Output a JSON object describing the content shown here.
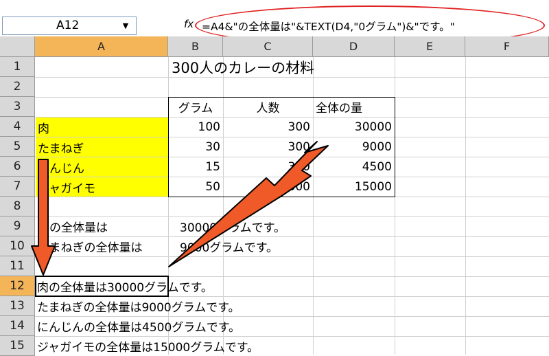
{
  "formula_bar": {
    "name_box": "A12",
    "name_box_dropdown": "▼",
    "fx_label": "fx",
    "formula": "=A4&\"の全体量は\"&TEXT(D4,\"0グラム\")&\"です。\""
  },
  "columns": [
    "A",
    "B",
    "C",
    "D",
    "E",
    "F"
  ],
  "rows": [
    "1",
    "2",
    "3",
    "4",
    "5",
    "6",
    "7",
    "8",
    "9",
    "10",
    "11",
    "12",
    "13",
    "14",
    "15"
  ],
  "cells": {
    "title": "300人のカレーの材料",
    "headers": {
      "b": "グラム",
      "c": "人数",
      "d": "全体の量"
    },
    "ingredients": [
      {
        "a": "肉",
        "b": "100",
        "c": "300",
        "d": "30000"
      },
      {
        "a": "たまねぎ",
        "b": "30",
        "c": "300",
        "d": "9000"
      },
      {
        "a": "にんじん",
        "b": "15",
        "c": "300",
        "d": "4500"
      },
      {
        "a": "ジャガイモ",
        "b": "50",
        "c": "300",
        "d": "15000"
      }
    ],
    "row9_label": "肉の全体量は",
    "row9_value": "30000グラムです。",
    "row10_label": "たまねぎの全体量は",
    "row10_value": "9000グラムです。",
    "results": [
      "肉の全体量は30000グラムです。",
      "たまねぎの全体量は9000グラムです。",
      "にんじんの全体量は4500グラムです。",
      "ジャガイモの全体量は15000グラムです。"
    ]
  },
  "selected_cell": "A12",
  "colors": {
    "highlight": "#ffff00",
    "arrow": "#f05a28",
    "oval": "#e02020",
    "header_selected": "#f4b458"
  }
}
